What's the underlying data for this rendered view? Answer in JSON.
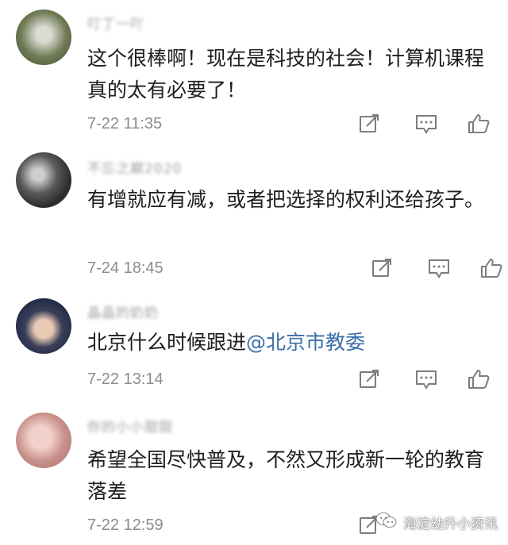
{
  "comments": [
    {
      "username": "叮丁一吖",
      "text": "这个很棒啊！现在是科技的社会！计算机课程真的太有必要了！",
      "mention": "",
      "time": "7-22 11:35"
    },
    {
      "username": "不忘之巅2020",
      "text": "有增就应有减，或者把选择的权利还给孩子。",
      "mention": "",
      "time": "7-24 18:45"
    },
    {
      "username": "晶晶的奶奶",
      "text": "北京什么时候跟进",
      "mention": "@北京市教委",
      "time": "7-22 13:14"
    },
    {
      "username": "你的小小甜甜",
      "text": "希望全国尽快普及，不然又形成新一轮的教育落差",
      "mention": "",
      "time": "7-22 12:59"
    }
  ],
  "icons": [
    "share-icon",
    "reply-icon",
    "like-icon"
  ],
  "colors": {
    "mention": "#3c6ea8",
    "meta": "#8c8c8c",
    "icon": "#7d7d7d"
  },
  "watermark": {
    "text": "海淀幼升小资讯",
    "icon": "wechat-icon"
  }
}
